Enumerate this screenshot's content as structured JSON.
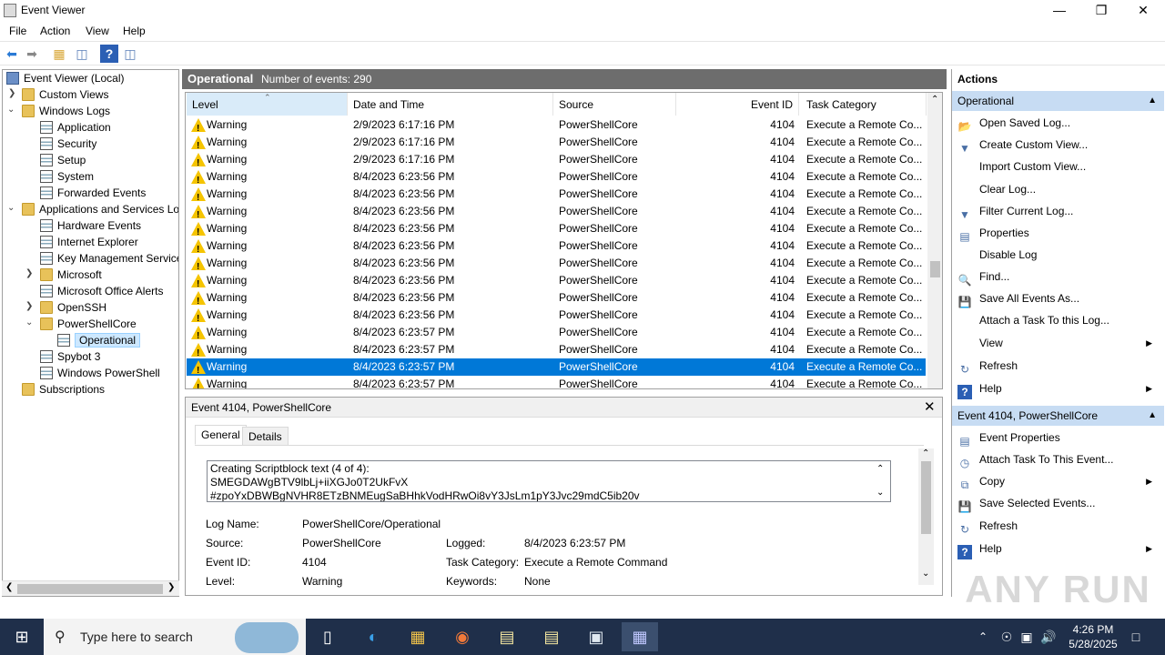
{
  "window": {
    "title": "Event Viewer"
  },
  "menu": [
    "File",
    "Action",
    "View",
    "Help"
  ],
  "tree": {
    "root": "Event Viewer (Local)",
    "custom_views": "Custom Views",
    "windows_logs": "Windows Logs",
    "application": "Application",
    "security": "Security",
    "setup": "Setup",
    "system": "System",
    "forwarded": "Forwarded Events",
    "apps_services": "Applications and Services Lo",
    "hardware": "Hardware Events",
    "ie": "Internet Explorer",
    "kms": "Key Management Service",
    "microsoft": "Microsoft",
    "office": "Microsoft Office Alerts",
    "openssh": "OpenSSH",
    "powershellcore": "PowerShellCore",
    "operational": "Operational",
    "spybot": "Spybot 3",
    "winps": "Windows PowerShell",
    "subscriptions": "Subscriptions"
  },
  "center": {
    "title": "Operational",
    "count": "Number of events: 290"
  },
  "columns": [
    "Level",
    "Date and Time",
    "Source",
    "Event ID",
    "Task Category"
  ],
  "rows": [
    {
      "level": "Warning",
      "date": "2/9/2023 6:17:16 PM",
      "source": "PowerShellCore",
      "id": "4104",
      "task": "Execute a Remote Co..."
    },
    {
      "level": "Warning",
      "date": "2/9/2023 6:17:16 PM",
      "source": "PowerShellCore",
      "id": "4104",
      "task": "Execute a Remote Co..."
    },
    {
      "level": "Warning",
      "date": "2/9/2023 6:17:16 PM",
      "source": "PowerShellCore",
      "id": "4104",
      "task": "Execute a Remote Co..."
    },
    {
      "level": "Warning",
      "date": "8/4/2023 6:23:56 PM",
      "source": "PowerShellCore",
      "id": "4104",
      "task": "Execute a Remote Co..."
    },
    {
      "level": "Warning",
      "date": "8/4/2023 6:23:56 PM",
      "source": "PowerShellCore",
      "id": "4104",
      "task": "Execute a Remote Co..."
    },
    {
      "level": "Warning",
      "date": "8/4/2023 6:23:56 PM",
      "source": "PowerShellCore",
      "id": "4104",
      "task": "Execute a Remote Co..."
    },
    {
      "level": "Warning",
      "date": "8/4/2023 6:23:56 PM",
      "source": "PowerShellCore",
      "id": "4104",
      "task": "Execute a Remote Co..."
    },
    {
      "level": "Warning",
      "date": "8/4/2023 6:23:56 PM",
      "source": "PowerShellCore",
      "id": "4104",
      "task": "Execute a Remote Co..."
    },
    {
      "level": "Warning",
      "date": "8/4/2023 6:23:56 PM",
      "source": "PowerShellCore",
      "id": "4104",
      "task": "Execute a Remote Co..."
    },
    {
      "level": "Warning",
      "date": "8/4/2023 6:23:56 PM",
      "source": "PowerShellCore",
      "id": "4104",
      "task": "Execute a Remote Co..."
    },
    {
      "level": "Warning",
      "date": "8/4/2023 6:23:56 PM",
      "source": "PowerShellCore",
      "id": "4104",
      "task": "Execute a Remote Co..."
    },
    {
      "level": "Warning",
      "date": "8/4/2023 6:23:56 PM",
      "source": "PowerShellCore",
      "id": "4104",
      "task": "Execute a Remote Co..."
    },
    {
      "level": "Warning",
      "date": "8/4/2023 6:23:57 PM",
      "source": "PowerShellCore",
      "id": "4104",
      "task": "Execute a Remote Co..."
    },
    {
      "level": "Warning",
      "date": "8/4/2023 6:23:57 PM",
      "source": "PowerShellCore",
      "id": "4104",
      "task": "Execute a Remote Co..."
    },
    {
      "level": "Warning",
      "date": "8/4/2023 6:23:57 PM",
      "source": "PowerShellCore",
      "id": "4104",
      "task": "Execute a Remote Co..."
    },
    {
      "level": "Warning",
      "date": "8/4/2023 6:23:57 PM",
      "source": "PowerShellCore",
      "id": "4104",
      "task": "Execute a Remote Co..."
    }
  ],
  "selected_row": 14,
  "detail": {
    "title": "Event 4104, PowerShellCore",
    "tabs": [
      "General",
      "Details"
    ],
    "script": [
      "Creating Scriptblock text (4 of 4):",
      "SMEGDAWgBTV9lbLj+iiXGJo0T2UkFvX",
      "#zpoYxDBWBgNVHR8ETzBNMEugSaBHhkVodHRwOi8vY3JsLm1pY3Jvc29mdC5ib20v"
    ],
    "log_name_label": "Log Name:",
    "log_name": "PowerShellCore/Operational",
    "source_label": "Source:",
    "source": "PowerShellCore",
    "logged_label": "Logged:",
    "logged": "8/4/2023 6:23:57 PM",
    "event_id_label": "Event ID:",
    "event_id": "4104",
    "task_label": "Task Category:",
    "task": "Execute a Remote Command",
    "level_label": "Level:",
    "level": "Warning",
    "keywords_label": "Keywords:",
    "keywords": "None"
  },
  "actions": {
    "title": "Actions",
    "section1": "Operational",
    "items1": [
      "Open Saved Log...",
      "Create Custom View...",
      "Import Custom View...",
      "Clear Log...",
      "Filter Current Log...",
      "Properties",
      "Disable Log",
      "Find...",
      "Save All Events As...",
      "Attach a Task To this Log...",
      "View",
      "Refresh",
      "Help"
    ],
    "section2": "Event 4104, PowerShellCore",
    "items2": [
      "Event Properties",
      "Attach Task To This Event...",
      "Copy",
      "Save Selected Events...",
      "Refresh",
      "Help"
    ]
  },
  "taskbar": {
    "search_placeholder": "Type here to search",
    "time": "4:26 PM",
    "date": "5/28/2025"
  },
  "watermark": "ANY RUN"
}
